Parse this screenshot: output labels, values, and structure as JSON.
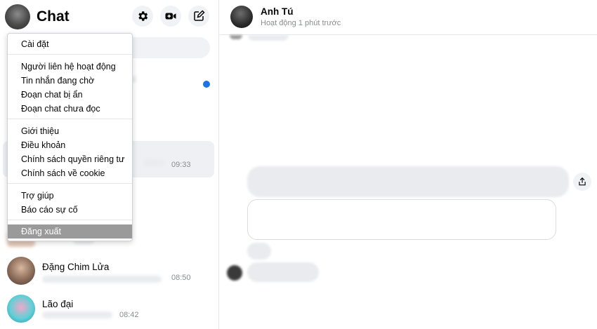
{
  "header": {
    "title": "Chat",
    "settings_icon": "gear-icon",
    "video_icon": "video-call-icon",
    "compose_icon": "compose-icon"
  },
  "menu": {
    "groups": [
      [
        "Cài đặt"
      ],
      [
        "Người liên hệ hoạt động",
        "Tin nhắn đang chờ",
        "Đoạn chat bị ẩn",
        "Đoạn chat chưa đọc"
      ],
      [
        "Giới thiệu",
        "Điều khoản",
        "Chính sách quyền riêng tư",
        "Chính sách về cookie"
      ],
      [
        "Trợ giúp",
        "Báo cáo sự cố"
      ],
      [
        "Đăng xuất"
      ]
    ],
    "items": {
      "settings": "Cài đặt",
      "active_contacts": "Người liên hệ hoạt động",
      "message_requests": "Tin nhắn đang chờ",
      "hidden_chats": "Đoạn chat bị ẩn",
      "unread_chats": "Đoạn chat chưa đọc",
      "about": "Giới thiệu",
      "terms": "Điều khoản",
      "privacy": "Chính sách quyền riêng tư",
      "cookies": "Chính sách về cookie",
      "help": "Trợ giúp",
      "report": "Báo cáo sự cố",
      "logout": "Đăng xuất"
    }
  },
  "conversations": [
    {
      "name": "",
      "time": "09:33"
    },
    {
      "name": "Đặng Chim Lửa",
      "time": "08:50"
    },
    {
      "name": "Lão đại",
      "time": "08:42"
    }
  ],
  "chat": {
    "peer_name": "Anh Tú",
    "peer_status": "Hoạt động 1 phút trước",
    "share_icon": "share-icon"
  },
  "colors": {
    "accent": "#1b74e4",
    "menu_highlight": "#9a9a9a"
  }
}
